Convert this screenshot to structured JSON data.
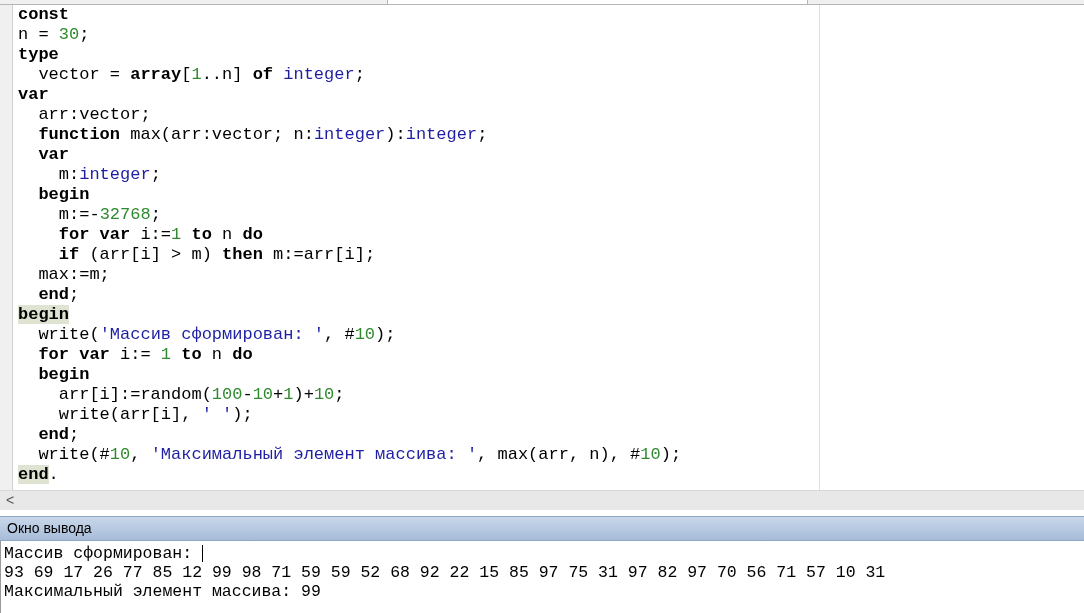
{
  "editor": {
    "lines": [
      [
        {
          "text": "const",
          "kind": "keyword"
        }
      ],
      [
        {
          "text": "n = ",
          "kind": "plain"
        },
        {
          "text": "30",
          "kind": "number"
        },
        {
          "text": ";",
          "kind": "plain"
        }
      ],
      [
        {
          "text": "type",
          "kind": "keyword"
        }
      ],
      [
        {
          "text": "  vector = ",
          "kind": "plain"
        },
        {
          "text": "array",
          "kind": "keyword"
        },
        {
          "text": "[",
          "kind": "plain"
        },
        {
          "text": "1",
          "kind": "number"
        },
        {
          "text": "..n] ",
          "kind": "plain"
        },
        {
          "text": "of ",
          "kind": "keyword"
        },
        {
          "text": "integer",
          "kind": "type"
        },
        {
          "text": ";",
          "kind": "plain"
        }
      ],
      [
        {
          "text": "var",
          "kind": "keyword"
        }
      ],
      [
        {
          "text": "  arr:vector;",
          "kind": "plain"
        }
      ],
      [
        {
          "text": "  function",
          "kind": "keyword"
        },
        {
          "text": " max(arr:vector; n:",
          "kind": "plain"
        },
        {
          "text": "integer",
          "kind": "type"
        },
        {
          "text": "):",
          "kind": "plain"
        },
        {
          "text": "integer",
          "kind": "type"
        },
        {
          "text": ";",
          "kind": "plain"
        }
      ],
      [
        {
          "text": "  var",
          "kind": "keyword"
        }
      ],
      [
        {
          "text": "    m:",
          "kind": "plain"
        },
        {
          "text": "integer",
          "kind": "type"
        },
        {
          "text": ";",
          "kind": "plain"
        }
      ],
      [
        {
          "text": "  begin",
          "kind": "keyword"
        }
      ],
      [
        {
          "text": "    m:=-",
          "kind": "plain"
        },
        {
          "text": "32768",
          "kind": "number"
        },
        {
          "text": ";",
          "kind": "plain"
        }
      ],
      [
        {
          "text": "    for var",
          "kind": "keyword"
        },
        {
          "text": " i:=",
          "kind": "plain"
        },
        {
          "text": "1",
          "kind": "number"
        },
        {
          "text": " to",
          "kind": "keyword"
        },
        {
          "text": " n ",
          "kind": "plain"
        },
        {
          "text": "do",
          "kind": "keyword"
        }
      ],
      [
        {
          "text": "    if",
          "kind": "keyword"
        },
        {
          "text": " (arr[i] > m) ",
          "kind": "plain"
        },
        {
          "text": "then",
          "kind": "keyword"
        },
        {
          "text": " m:=arr[i];",
          "kind": "plain"
        }
      ],
      [
        {
          "text": "  max:=m;",
          "kind": "plain"
        }
      ],
      [
        {
          "text": "  end",
          "kind": "keyword"
        },
        {
          "text": ";",
          "kind": "plain"
        }
      ],
      [
        {
          "text": "begin",
          "kind": "keyword",
          "highlighted": true
        }
      ],
      [
        {
          "text": "  write(",
          "kind": "plain"
        },
        {
          "text": "'Массив сформирован: '",
          "kind": "string"
        },
        {
          "text": ", #",
          "kind": "plain"
        },
        {
          "text": "10",
          "kind": "number"
        },
        {
          "text": ");",
          "kind": "plain"
        }
      ],
      [
        {
          "text": "  for var",
          "kind": "keyword"
        },
        {
          "text": " i:= ",
          "kind": "plain"
        },
        {
          "text": "1",
          "kind": "number"
        },
        {
          "text": " to",
          "kind": "keyword"
        },
        {
          "text": " n ",
          "kind": "plain"
        },
        {
          "text": "do",
          "kind": "keyword"
        }
      ],
      [
        {
          "text": "  begin",
          "kind": "keyword"
        }
      ],
      [
        {
          "text": "    arr[i]:=random(",
          "kind": "plain"
        },
        {
          "text": "100",
          "kind": "number"
        },
        {
          "text": "-",
          "kind": "plain"
        },
        {
          "text": "10",
          "kind": "number"
        },
        {
          "text": "+",
          "kind": "plain"
        },
        {
          "text": "1",
          "kind": "number"
        },
        {
          "text": ")+",
          "kind": "plain"
        },
        {
          "text": "10",
          "kind": "number"
        },
        {
          "text": ";",
          "kind": "plain"
        }
      ],
      [
        {
          "text": "    write(arr[i], ",
          "kind": "plain"
        },
        {
          "text": "' '",
          "kind": "string"
        },
        {
          "text": ");",
          "kind": "plain"
        }
      ],
      [
        {
          "text": "  end",
          "kind": "keyword"
        },
        {
          "text": ";",
          "kind": "plain"
        }
      ],
      [
        {
          "text": "  write(#",
          "kind": "plain"
        },
        {
          "text": "10",
          "kind": "number"
        },
        {
          "text": ", ",
          "kind": "plain"
        },
        {
          "text": "'Максимальный элемент массива: '",
          "kind": "string"
        },
        {
          "text": ", max(arr, n), #",
          "kind": "plain"
        },
        {
          "text": "10",
          "kind": "number"
        },
        {
          "text": ");",
          "kind": "plain"
        }
      ],
      [
        {
          "text": "end",
          "kind": "keyword",
          "highlighted": true
        },
        {
          "text": ".",
          "kind": "plain"
        }
      ]
    ],
    "scroll_left": "<"
  },
  "output": {
    "title": "Окно вывода",
    "lines": [
      {
        "text": "Массив сформирован: ",
        "cursor": true
      },
      {
        "text": "93 69 17 26 77 85 12 99 98 71 59 59 52 68 92 22 15 85 97 75 31 97 82 97 70 56 71 57 10 31",
        "cursor": false
      },
      {
        "text": "Максимальный элемент массива: 99",
        "cursor": false
      }
    ]
  }
}
